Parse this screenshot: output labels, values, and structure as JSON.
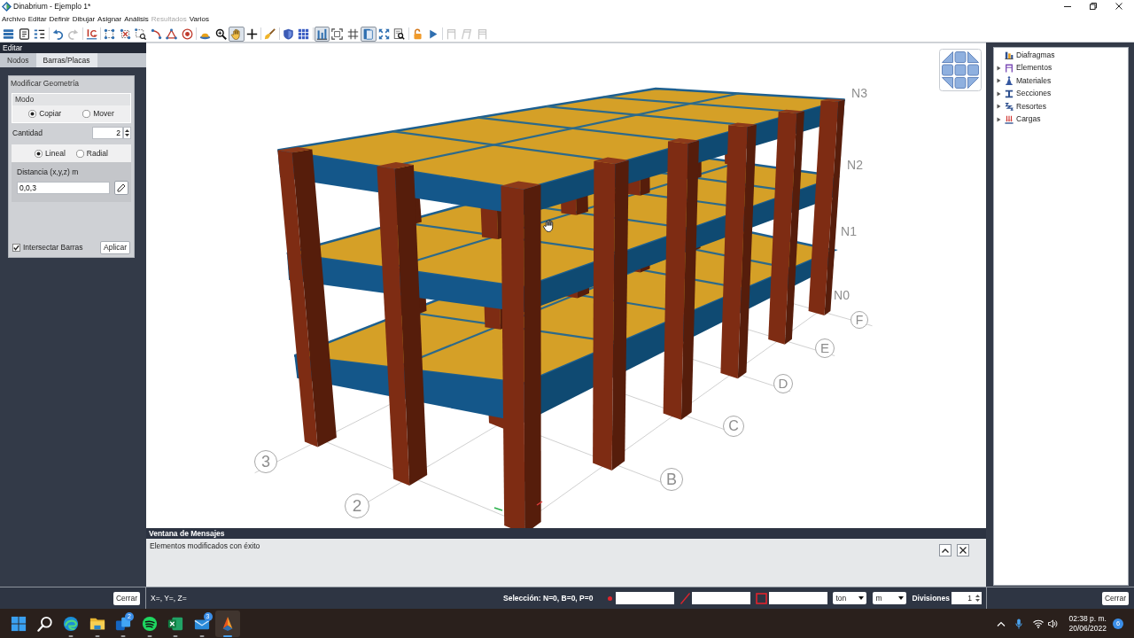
{
  "window": {
    "title": "Dinabrium - Ejemplo 1*"
  },
  "menu": [
    {
      "label": "Archivo",
      "disabled": false
    },
    {
      "label": "Editar",
      "disabled": false
    },
    {
      "label": "Definir",
      "disabled": false
    },
    {
      "label": "Dibujar",
      "disabled": false
    },
    {
      "label": "Asignar",
      "disabled": false
    },
    {
      "label": "Análisis",
      "disabled": false
    },
    {
      "label": "Resultados",
      "disabled": true
    },
    {
      "label": "Varios",
      "disabled": false
    }
  ],
  "toolbar": [
    [
      {
        "selected": false,
        "disabled": false
      },
      {
        "selected": false,
        "disabled": false
      },
      {
        "selected": false,
        "disabled": false
      }
    ],
    [
      {
        "selected": false,
        "disabled": false
      },
      {
        "selected": false,
        "disabled": true
      }
    ],
    [
      {
        "selected": false,
        "disabled": false
      }
    ],
    [
      {
        "selected": false,
        "disabled": false
      },
      {
        "selected": false,
        "disabled": false
      },
      {
        "selected": false,
        "disabled": false
      },
      {
        "selected": false,
        "disabled": false
      },
      {
        "selected": false,
        "disabled": false
      },
      {
        "selected": false,
        "disabled": false
      }
    ],
    [
      {
        "selected": false,
        "disabled": false
      },
      {
        "selected": false,
        "disabled": false
      },
      {
        "selected": true,
        "disabled": false
      },
      {
        "selected": false,
        "disabled": false
      }
    ],
    [
      {
        "selected": false,
        "disabled": false
      }
    ],
    [
      {
        "selected": false,
        "disabled": false
      },
      {
        "selected": false,
        "disabled": false
      }
    ],
    [
      {
        "selected": true,
        "disabled": false
      },
      {
        "selected": false,
        "disabled": false
      },
      {
        "selected": false,
        "disabled": false
      },
      {
        "selected": true,
        "disabled": false
      },
      {
        "selected": false,
        "disabled": false
      },
      {
        "selected": false,
        "disabled": false
      }
    ],
    [
      {
        "selected": false,
        "disabled": false
      },
      {
        "selected": false,
        "disabled": false
      }
    ],
    [
      {
        "selected": false,
        "disabled": true
      },
      {
        "selected": false,
        "disabled": true
      },
      {
        "selected": false,
        "disabled": true
      }
    ]
  ],
  "left_panel": {
    "title": "Editar",
    "tabs": [
      {
        "label": "Nodos",
        "selected": false
      },
      {
        "label": "Barras/Placas",
        "selected": true
      }
    ],
    "group": {
      "title": "Modificar Geometría",
      "mode": {
        "title": "Modo",
        "options": [
          {
            "label": "Copiar",
            "selected": true
          },
          {
            "label": "Mover",
            "selected": false
          }
        ]
      },
      "quantity": {
        "label": "Cantidad",
        "value": "2"
      },
      "type_options": [
        {
          "label": "Lineal",
          "selected": true
        },
        {
          "label": "Radial",
          "selected": false
        }
      ],
      "distance": {
        "label": "Distancia (x,y,z) m",
        "value": "0,0,3"
      },
      "intersect": {
        "label": "Intersectar Barras",
        "checked": true
      },
      "apply_button": "Aplicar"
    }
  },
  "viewport": {
    "level_labels": [
      "N3",
      "N2",
      "N1",
      "N0"
    ],
    "axis_labels": [
      "F",
      "E",
      "D",
      "C",
      "B"
    ],
    "row_labels": [
      "3",
      "2"
    ]
  },
  "tree": [
    {
      "label": "Diafragmas",
      "kind": "leaf"
    },
    {
      "label": "Elementos",
      "kind": "branch",
      "expanded": false
    },
    {
      "label": "Materiales",
      "kind": "branch",
      "expanded": false
    },
    {
      "label": "Secciones",
      "kind": "branch",
      "expanded": false
    },
    {
      "label": "Resortes",
      "kind": "branch",
      "expanded": false
    },
    {
      "label": "Cargas",
      "kind": "branch",
      "expanded": false
    }
  ],
  "messages": {
    "title": "Ventana de Mensajes",
    "lines": [
      "Elementos modificados con éxito"
    ]
  },
  "status_bar": {
    "left_button": "Cerrar",
    "coordinates": "X=, Y=, Z=",
    "selection": "Selección: N=0, B=0, P=0",
    "force_unit": "ton",
    "length_unit": "m",
    "divisions_label": "Divisiones",
    "divisions_value": "1",
    "right_button": "Cerrar"
  },
  "taskbar": {
    "apps": [
      {
        "running": false,
        "selected": false
      },
      {
        "running": false,
        "selected": false
      },
      {
        "running": true,
        "selected": false
      },
      {
        "running": true,
        "selected": false
      },
      {
        "running": true,
        "selected": false,
        "badge": "2"
      },
      {
        "running": true,
        "selected": false
      },
      {
        "running": true,
        "selected": false
      },
      {
        "running": true,
        "selected": false,
        "badge": "3"
      },
      {
        "running": true,
        "selected": true
      }
    ],
    "time": "02:38 p. m.",
    "date": "20/06/2022",
    "notification_count": "6"
  }
}
